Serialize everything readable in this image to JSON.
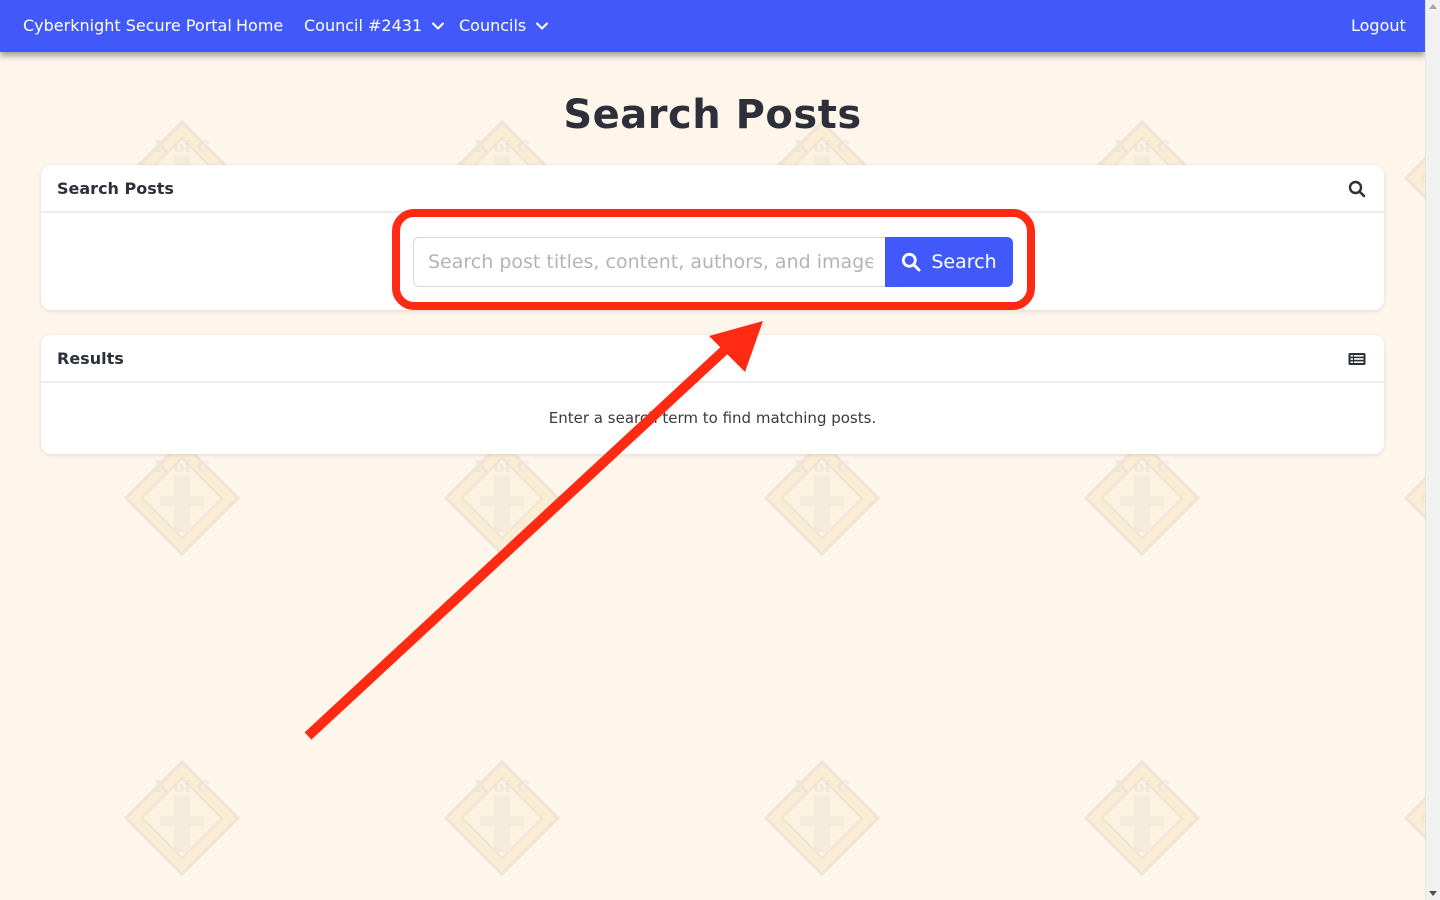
{
  "navbar": {
    "brand": "Cyberknight Secure Portal",
    "home": "Home",
    "council_menu": "Council #2431",
    "councils_menu": "Councils",
    "logout": "Logout"
  },
  "page": {
    "title": "Search Posts"
  },
  "search_card": {
    "header": "Search Posts",
    "header_icon": "search-icon",
    "input_value": "",
    "input_placeholder": "Search post titles, content, authors, and image alt text",
    "button_label": "Search",
    "button_icon": "search-icon"
  },
  "results_card": {
    "header": "Results",
    "header_icon": "list-icon",
    "empty_message": "Enter a search term to find matching posts."
  },
  "watermark": {
    "label": "K of C"
  },
  "colors": {
    "primary": "#4159fa",
    "background": "#fef6ea",
    "annotation": "#ff2a14"
  }
}
